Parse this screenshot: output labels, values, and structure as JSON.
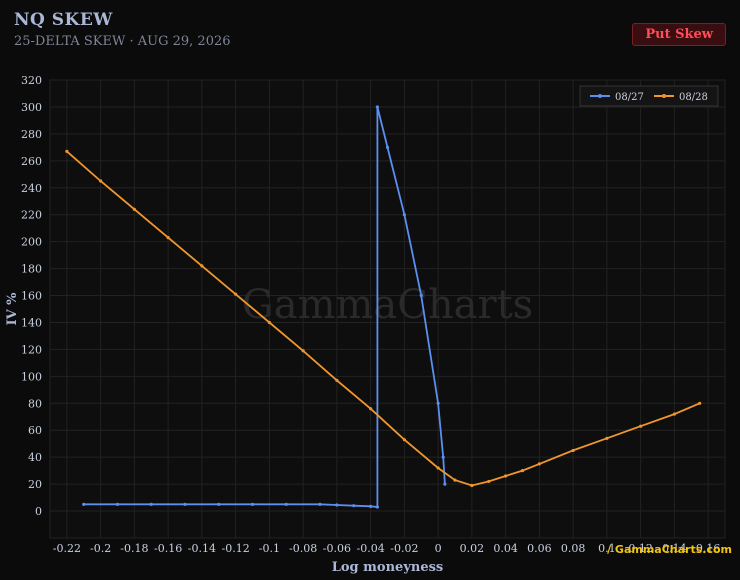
{
  "header": {
    "title": "NQ SKEW",
    "subtitle": "25-DELTA SKEW · AUG 29, 2026"
  },
  "badge": {
    "label": "Put Skew"
  },
  "watermark": "GammaCharts",
  "brand": "/ GammaCharts.com",
  "colors": {
    "series_0827": "#5b8ff0",
    "series_0828": "#f0962e",
    "badge_text": "#ff4d5a",
    "brand": "#f1c40f"
  },
  "chart_data": {
    "type": "line",
    "title": "",
    "xlabel": "Log moneyness",
    "ylabel": "IV %",
    "xlim": [
      -0.23,
      0.17
    ],
    "ylim": [
      -20,
      320
    ],
    "grid": true,
    "legend_position": "top-right",
    "x_ticks": [
      -0.22,
      -0.2,
      -0.18,
      -0.16,
      -0.14,
      -0.12,
      -0.1,
      -0.08,
      -0.06,
      -0.04,
      -0.02,
      0,
      0.02,
      0.04,
      0.06,
      0.08,
      0.1,
      0.12,
      0.14,
      0.16
    ],
    "x_tick_labels": [
      "-0.22",
      "-0.2",
      "-0.18",
      "-0.16",
      "-0.14",
      "-0.12",
      "-0.1",
      "-0.08",
      "-0.06",
      "-0.04",
      "-0.02",
      "0",
      "0.02",
      "0.04",
      "0.06",
      "0.08",
      "0.1",
      "0.12",
      "0.14",
      "0.16"
    ],
    "y_ticks": [
      0,
      20,
      40,
      60,
      80,
      100,
      120,
      140,
      160,
      180,
      200,
      220,
      240,
      260,
      280,
      300,
      320
    ],
    "series": [
      {
        "name": "08/27",
        "points": [
          [
            -0.21,
            5
          ],
          [
            -0.19,
            5
          ],
          [
            -0.17,
            5
          ],
          [
            -0.15,
            5
          ],
          [
            -0.13,
            5
          ],
          [
            -0.11,
            5
          ],
          [
            -0.09,
            5
          ],
          [
            -0.07,
            5
          ],
          [
            -0.06,
            4.5
          ],
          [
            -0.05,
            4
          ],
          [
            -0.04,
            3.5
          ],
          [
            -0.036,
            3
          ],
          [
            -0.036,
            300
          ],
          [
            -0.03,
            270
          ],
          [
            -0.02,
            220
          ],
          [
            -0.01,
            160
          ],
          [
            0,
            80
          ],
          [
            0.003,
            40
          ],
          [
            0.004,
            20
          ]
        ]
      },
      {
        "name": "08/28",
        "points": [
          [
            -0.22,
            267
          ],
          [
            -0.2,
            245
          ],
          [
            -0.18,
            224
          ],
          [
            -0.16,
            203
          ],
          [
            -0.14,
            182
          ],
          [
            -0.12,
            161
          ],
          [
            -0.1,
            140
          ],
          [
            -0.08,
            119
          ],
          [
            -0.06,
            97
          ],
          [
            -0.04,
            76
          ],
          [
            -0.02,
            53
          ],
          [
            0,
            32
          ],
          [
            0.01,
            23
          ],
          [
            0.02,
            19
          ],
          [
            0.03,
            22
          ],
          [
            0.04,
            26
          ],
          [
            0.05,
            30
          ],
          [
            0.06,
            35
          ],
          [
            0.08,
            45
          ],
          [
            0.1,
            54
          ],
          [
            0.12,
            63
          ],
          [
            0.14,
            72
          ],
          [
            0.155,
            80
          ]
        ]
      }
    ]
  }
}
